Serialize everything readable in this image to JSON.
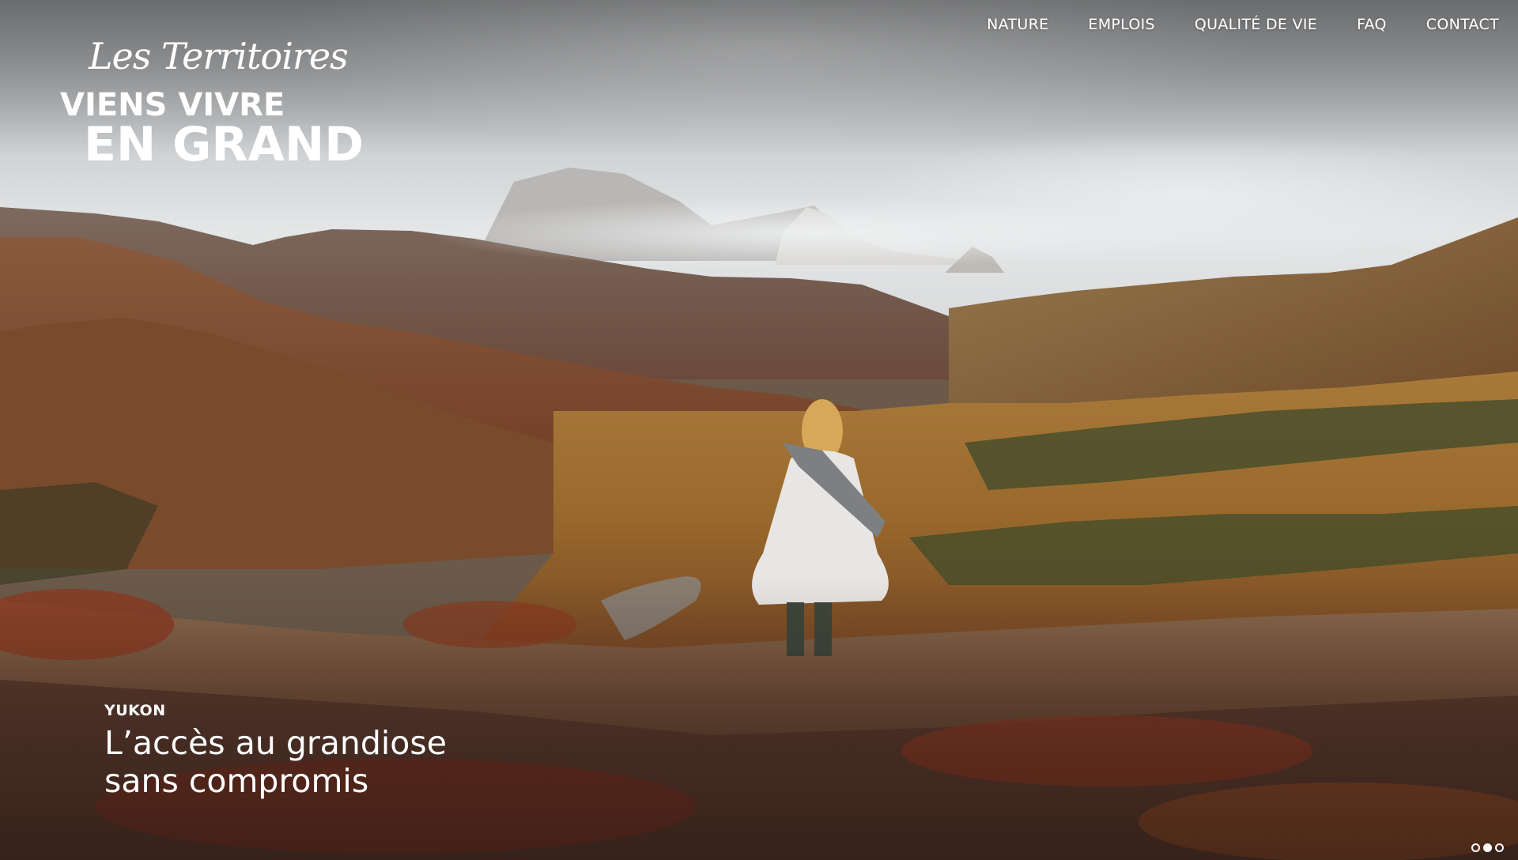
{
  "brand": {
    "script": "Les Territoires",
    "line1": "VIENS VIVRE",
    "line2": "EN GRAND"
  },
  "nav": {
    "items": [
      {
        "label": "NATURE"
      },
      {
        "label": "EMPLOIS"
      },
      {
        "label": "QUALITÉ DE VIE"
      },
      {
        "label": "FAQ"
      },
      {
        "label": "CONTACT"
      }
    ]
  },
  "hero": {
    "kicker": "YUKON",
    "title_line1": "L’accès au grandiose",
    "title_line2": "sans compromis"
  },
  "slider": {
    "slides": 3,
    "active_index": 1
  },
  "colors": {
    "text": "#ffffff",
    "sky": "#cfd2d4",
    "tundra_red": "#8a3a24",
    "tundra_gold": "#b88a2e"
  }
}
